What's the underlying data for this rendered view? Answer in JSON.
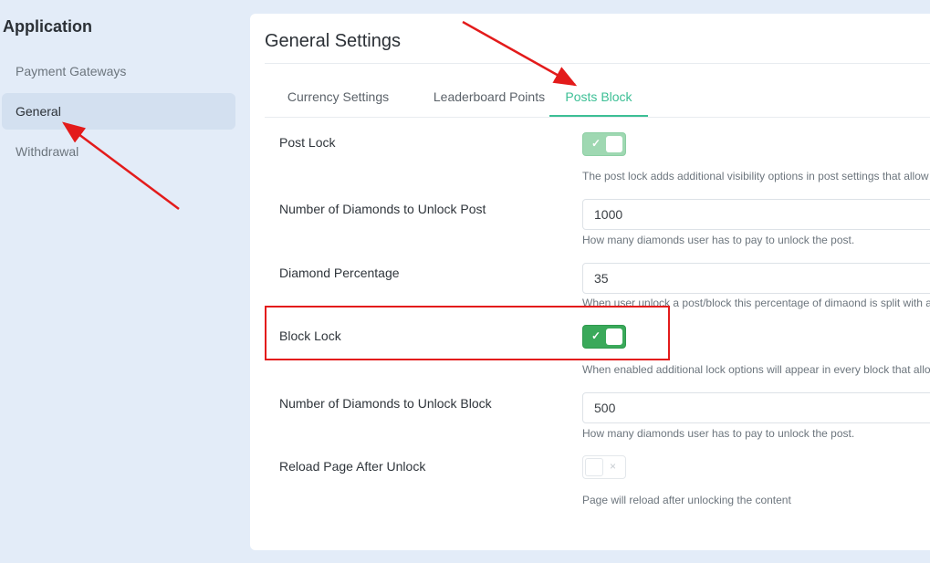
{
  "sidebar": {
    "title": "Application",
    "items": [
      {
        "label": "Payment Gateways",
        "active": false
      },
      {
        "label": "General",
        "active": true
      },
      {
        "label": "Withdrawal",
        "active": false
      }
    ]
  },
  "card": {
    "title": "General Settings",
    "tabs": [
      {
        "label": "Currency Settings",
        "active": false
      },
      {
        "label": "Leaderboard Points",
        "active": false
      },
      {
        "label": "Posts Block",
        "active": true
      }
    ],
    "settings": {
      "post_lock": {
        "label": "Post Lock",
        "enabled": true,
        "help": "The post lock adds additional visibility options in post settings that allow"
      },
      "diamonds_post": {
        "label": "Number of Diamonds to Unlock Post",
        "value": "1000",
        "help": "How many diamonds user has to pay to unlock the post."
      },
      "diamond_percentage": {
        "label": "Diamond Percentage",
        "value": "35",
        "help": "When user unlock a post/block this percentage of dimaond is split with a"
      },
      "block_lock": {
        "label": "Block Lock",
        "enabled": true,
        "help": "When enabled additional lock options will appear in every block that allo"
      },
      "diamonds_block": {
        "label": "Number of Diamonds to Unlock Block",
        "value": "500",
        "help": "How many diamonds user has to pay to unlock the post."
      },
      "reload_page": {
        "label": "Reload Page After Unlock",
        "enabled": false,
        "help": "Page will reload after unlocking the content"
      }
    }
  },
  "icons": {
    "toggle_on": "✓",
    "toggle_off": "×"
  },
  "colors": {
    "accent": "#3cbf95",
    "toggle_on": "#3aa95a",
    "annotation": "#e31b1b"
  }
}
